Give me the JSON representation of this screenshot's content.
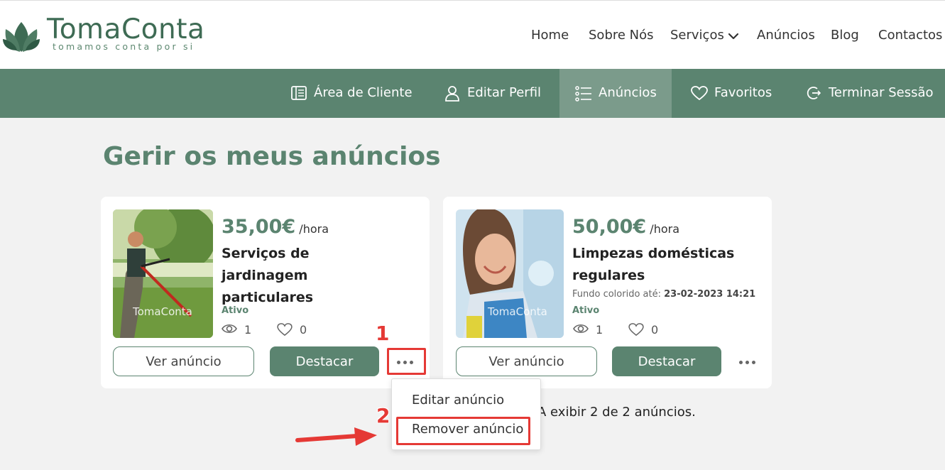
{
  "brand": {
    "name": "TomaConta",
    "tagline": "tomamos conta por si",
    "color": "#3e6b54"
  },
  "main_nav": [
    "Home",
    "Sobre Nós",
    "Serviços",
    "Anúncios",
    "Blog",
    "Contactos"
  ],
  "sub_nav": [
    {
      "label": "Área de Cliente",
      "icon": "dashboard-icon"
    },
    {
      "label": "Editar Perfil",
      "icon": "user-icon"
    },
    {
      "label": "Anúncios",
      "icon": "list-icon",
      "active": true
    },
    {
      "label": "Favoritos",
      "icon": "heart-icon"
    },
    {
      "label": "Terminar Sessão",
      "icon": "logout-icon"
    }
  ],
  "accent_color": "#5b8470",
  "page_title": "Gerir os meus anúncios",
  "ads": [
    {
      "price": "35,00€",
      "unit": "/hora",
      "title": "Serviços de jardinagem particulares",
      "boost_label": "",
      "boost_date": "",
      "status": "Ativo",
      "views": "1",
      "favorites": "0",
      "view_button": "Ver anúncio",
      "highlight_button": "Destacar",
      "image_watermark": "TomaConta"
    },
    {
      "price": "50,00€",
      "unit": "/hora",
      "title": "Limpezas domésticas regulares",
      "boost_label": "Fundo colorido até:",
      "boost_date": "23-02-2023 14:21",
      "status": "Ativo",
      "views": "1",
      "favorites": "0",
      "view_button": "Ver anúncio",
      "highlight_button": "Destacar",
      "image_watermark": "TomaConta"
    }
  ],
  "listing_count": "A exibir 2 de 2 anúncios.",
  "menu": {
    "edit": "Editar anúncio",
    "remove": "Remover anúncio"
  },
  "annotations": {
    "step1": "1",
    "step2": "2",
    "color": "#e53935"
  }
}
